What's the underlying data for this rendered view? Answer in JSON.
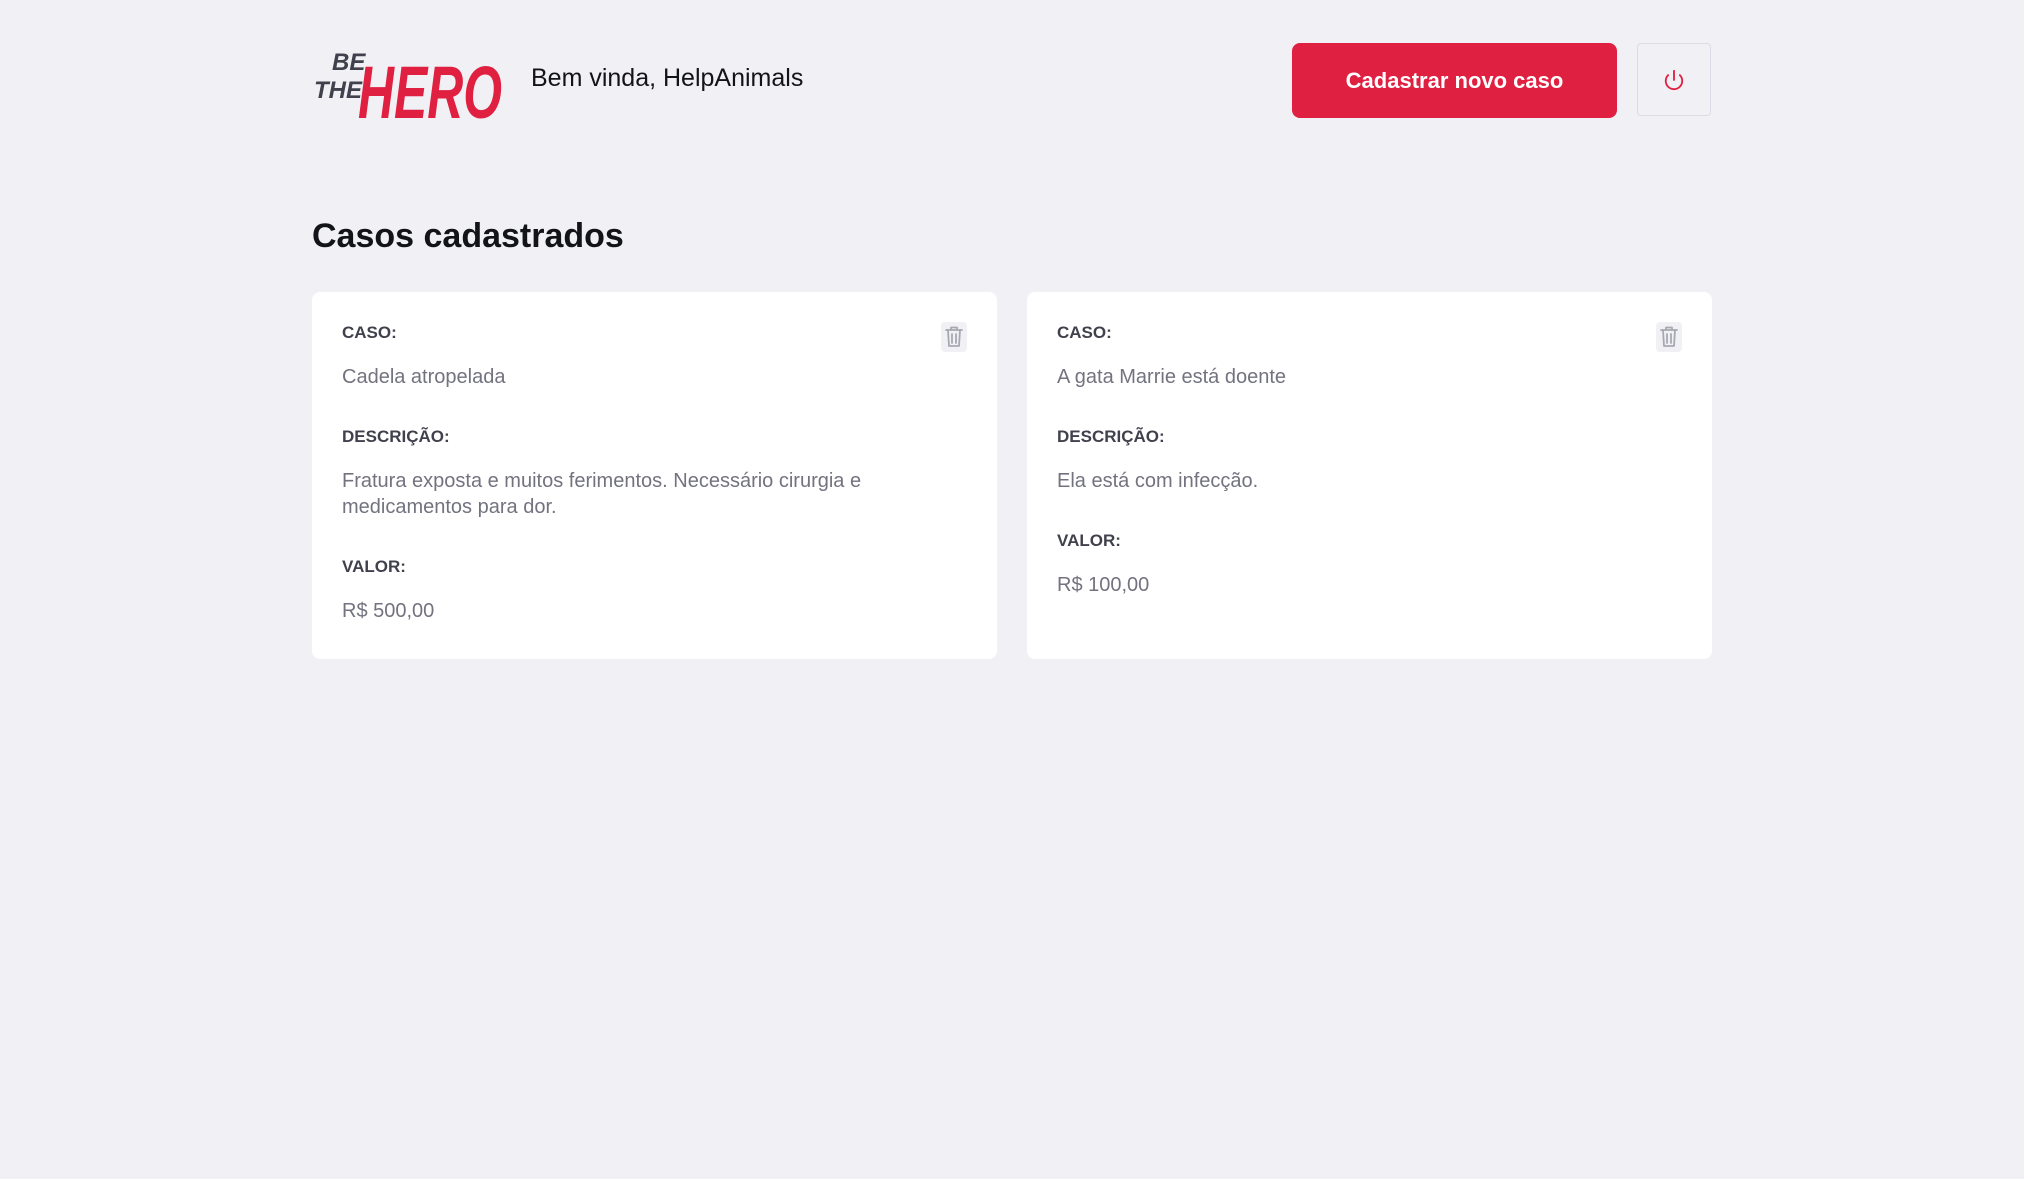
{
  "header": {
    "logo_text_top": "BE",
    "logo_text_mid": "THE",
    "logo_text_main": "HERO",
    "greeting": "Bem vinda, HelpAnimals",
    "new_case_label": "Cadastrar novo caso",
    "logout_icon": "power-icon"
  },
  "main": {
    "title": "Casos cadastrados",
    "cases": [
      {
        "case_label": "CASO:",
        "case_value": "Cadela atropelada",
        "description_label": "DESCRIÇÃO:",
        "description_value": "Fratura exposta e muitos ferimentos. Necessário cirurgia e medicamentos para dor.",
        "value_label": "VALOR:",
        "value_value": "R$ 500,00",
        "delete_icon": "trash-icon"
      },
      {
        "case_label": "CASO:",
        "case_value": "A gata Marrie está doente",
        "description_label": "DESCRIÇÃO:",
        "description_value": "Ela está com infecção.",
        "value_label": "VALOR:",
        "value_value": "R$ 100,00",
        "delete_icon": "trash-icon"
      }
    ]
  },
  "colors": {
    "brand": "#e02041",
    "background": "#f0f0f5",
    "card": "#ffffff",
    "label": "#41414d",
    "muted": "#737380"
  }
}
